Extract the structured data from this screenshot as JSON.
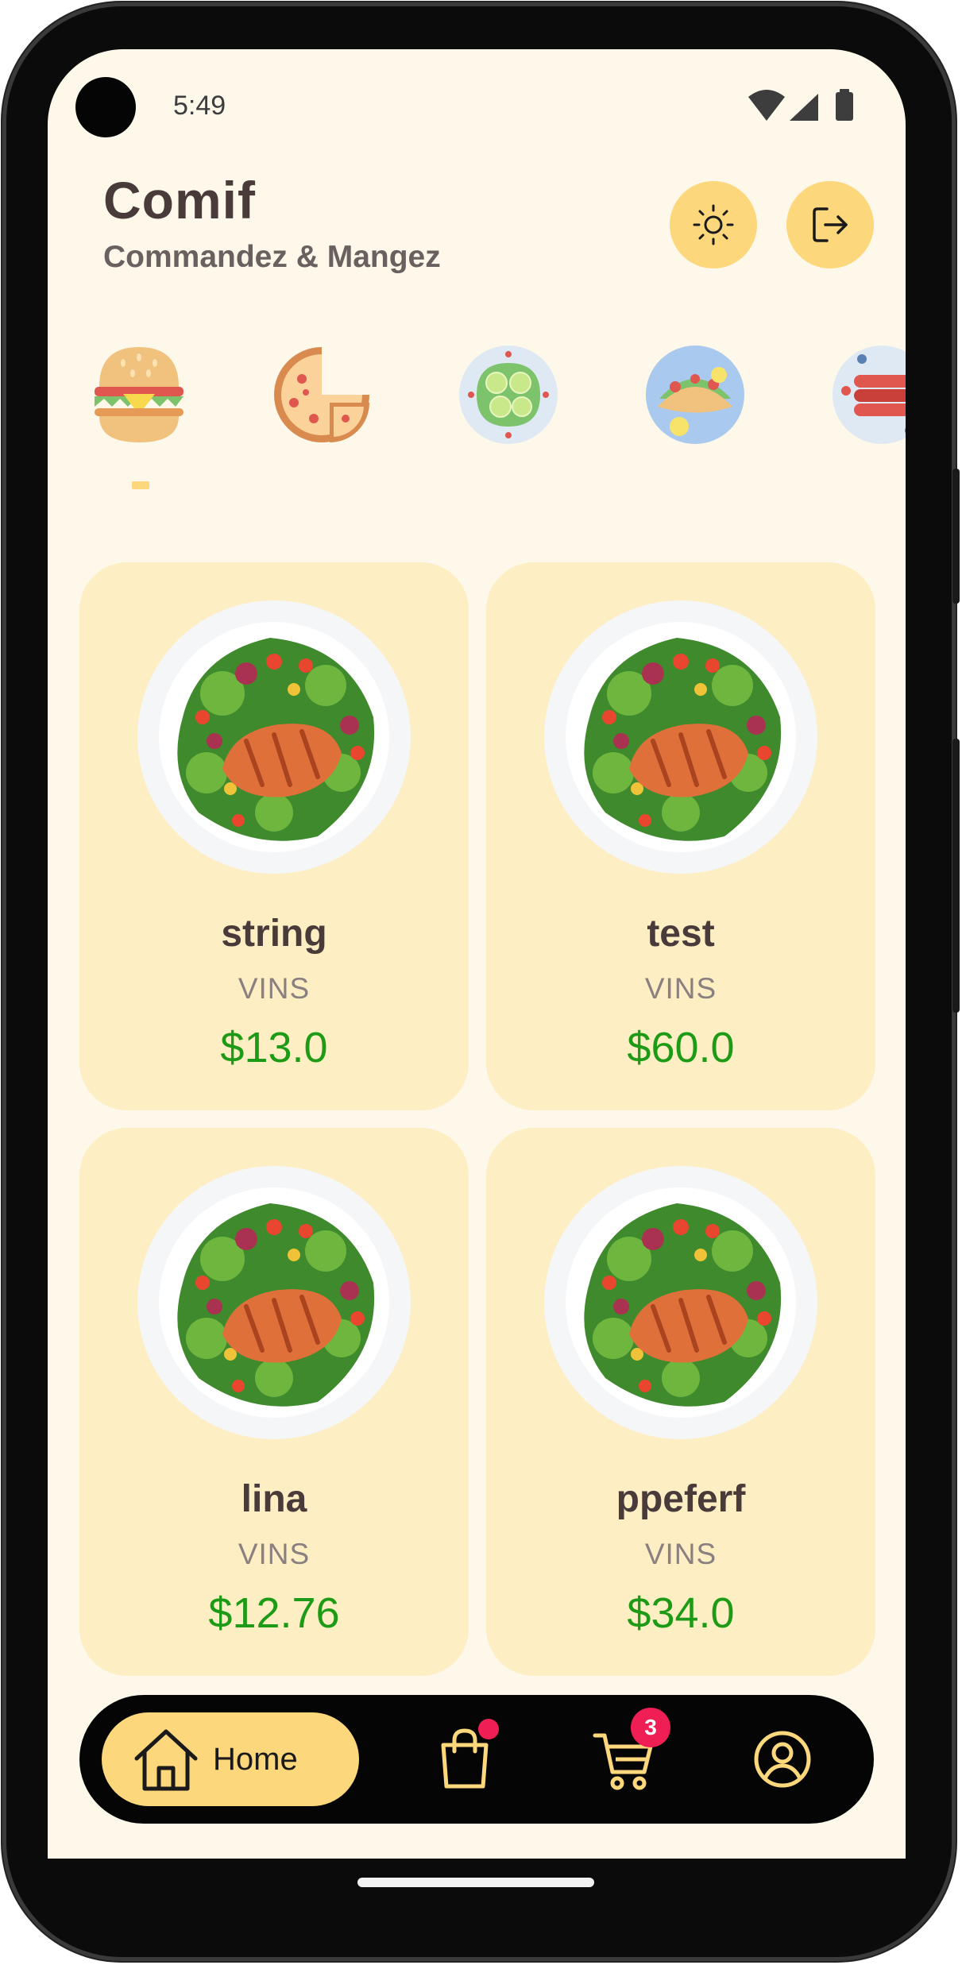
{
  "status_bar": {
    "time": "5:49"
  },
  "header": {
    "title": "Comif",
    "subtitle": "Commandez & Mangez",
    "theme_icon": "sun-icon",
    "logout_icon": "logout-icon"
  },
  "categories": [
    {
      "icon": "burger",
      "selected": true
    },
    {
      "icon": "pizza",
      "selected": false
    },
    {
      "icon": "salad",
      "selected": false
    },
    {
      "icon": "taco",
      "selected": false
    },
    {
      "icon": "sausage",
      "selected": false
    }
  ],
  "products": [
    {
      "name": "string",
      "category": "VINS",
      "price": "$13.0"
    },
    {
      "name": "test",
      "category": "VINS",
      "price": "$60.0"
    },
    {
      "name": "lina",
      "category": "VINS",
      "price": "$12.76"
    },
    {
      "name": "ppeferf",
      "category": "VINS",
      "price": "$34.0"
    }
  ],
  "nav": {
    "home_label": "Home",
    "cart_count": "3"
  },
  "colors": {
    "accent": "#fdd77c",
    "card": "#fdeec3",
    "background": "#fdf8ea",
    "price": "#1e9b16",
    "badge": "#ef1f55",
    "title": "#4a3b3b"
  }
}
